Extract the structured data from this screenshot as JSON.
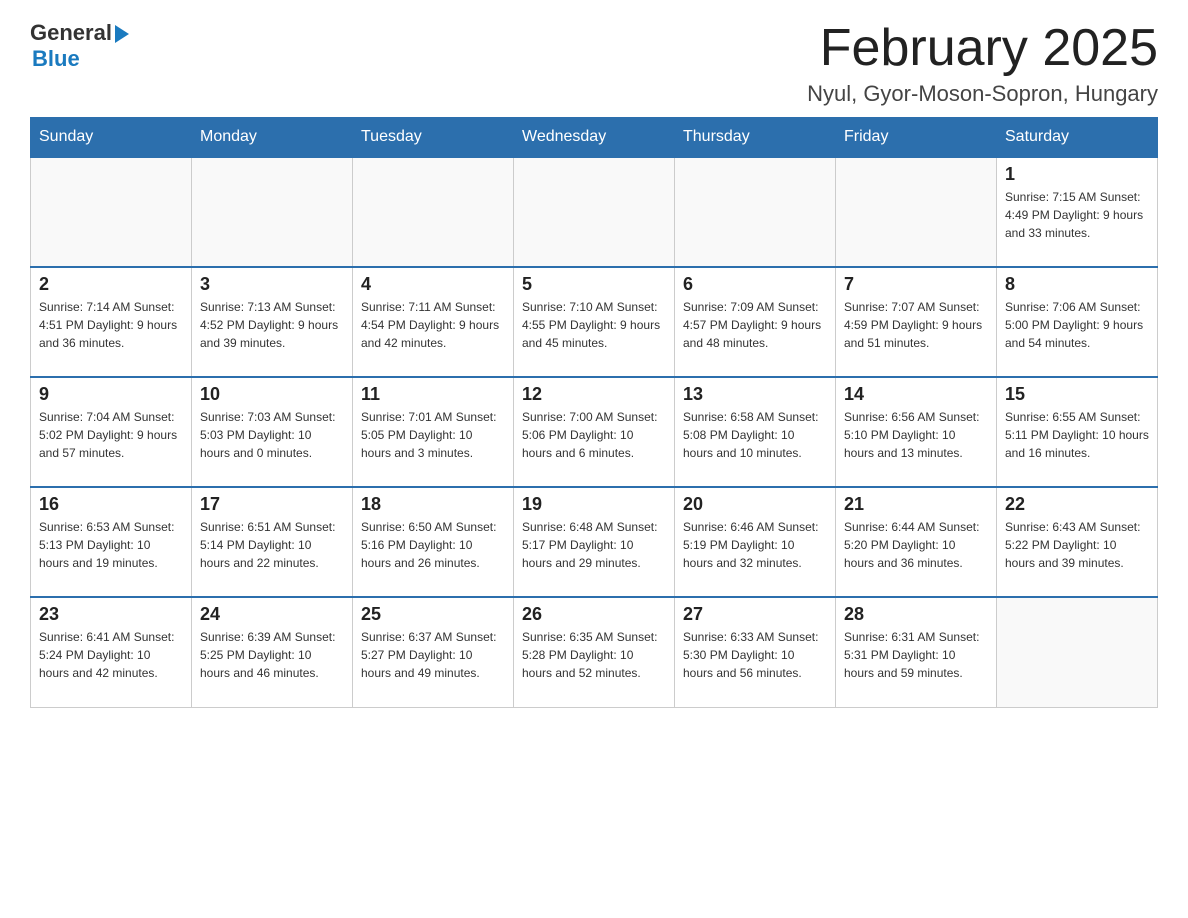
{
  "header": {
    "logo": {
      "general": "General",
      "blue": "Blue"
    },
    "title": "February 2025",
    "location": "Nyul, Gyor-Moson-Sopron, Hungary"
  },
  "days_of_week": [
    "Sunday",
    "Monday",
    "Tuesday",
    "Wednesday",
    "Thursday",
    "Friday",
    "Saturday"
  ],
  "weeks": [
    {
      "days": [
        {
          "number": "",
          "info": ""
        },
        {
          "number": "",
          "info": ""
        },
        {
          "number": "",
          "info": ""
        },
        {
          "number": "",
          "info": ""
        },
        {
          "number": "",
          "info": ""
        },
        {
          "number": "",
          "info": ""
        },
        {
          "number": "1",
          "info": "Sunrise: 7:15 AM\nSunset: 4:49 PM\nDaylight: 9 hours\nand 33 minutes."
        }
      ]
    },
    {
      "days": [
        {
          "number": "2",
          "info": "Sunrise: 7:14 AM\nSunset: 4:51 PM\nDaylight: 9 hours\nand 36 minutes."
        },
        {
          "number": "3",
          "info": "Sunrise: 7:13 AM\nSunset: 4:52 PM\nDaylight: 9 hours\nand 39 minutes."
        },
        {
          "number": "4",
          "info": "Sunrise: 7:11 AM\nSunset: 4:54 PM\nDaylight: 9 hours\nand 42 minutes."
        },
        {
          "number": "5",
          "info": "Sunrise: 7:10 AM\nSunset: 4:55 PM\nDaylight: 9 hours\nand 45 minutes."
        },
        {
          "number": "6",
          "info": "Sunrise: 7:09 AM\nSunset: 4:57 PM\nDaylight: 9 hours\nand 48 minutes."
        },
        {
          "number": "7",
          "info": "Sunrise: 7:07 AM\nSunset: 4:59 PM\nDaylight: 9 hours\nand 51 minutes."
        },
        {
          "number": "8",
          "info": "Sunrise: 7:06 AM\nSunset: 5:00 PM\nDaylight: 9 hours\nand 54 minutes."
        }
      ]
    },
    {
      "days": [
        {
          "number": "9",
          "info": "Sunrise: 7:04 AM\nSunset: 5:02 PM\nDaylight: 9 hours\nand 57 minutes."
        },
        {
          "number": "10",
          "info": "Sunrise: 7:03 AM\nSunset: 5:03 PM\nDaylight: 10 hours\nand 0 minutes."
        },
        {
          "number": "11",
          "info": "Sunrise: 7:01 AM\nSunset: 5:05 PM\nDaylight: 10 hours\nand 3 minutes."
        },
        {
          "number": "12",
          "info": "Sunrise: 7:00 AM\nSunset: 5:06 PM\nDaylight: 10 hours\nand 6 minutes."
        },
        {
          "number": "13",
          "info": "Sunrise: 6:58 AM\nSunset: 5:08 PM\nDaylight: 10 hours\nand 10 minutes."
        },
        {
          "number": "14",
          "info": "Sunrise: 6:56 AM\nSunset: 5:10 PM\nDaylight: 10 hours\nand 13 minutes."
        },
        {
          "number": "15",
          "info": "Sunrise: 6:55 AM\nSunset: 5:11 PM\nDaylight: 10 hours\nand 16 minutes."
        }
      ]
    },
    {
      "days": [
        {
          "number": "16",
          "info": "Sunrise: 6:53 AM\nSunset: 5:13 PM\nDaylight: 10 hours\nand 19 minutes."
        },
        {
          "number": "17",
          "info": "Sunrise: 6:51 AM\nSunset: 5:14 PM\nDaylight: 10 hours\nand 22 minutes."
        },
        {
          "number": "18",
          "info": "Sunrise: 6:50 AM\nSunset: 5:16 PM\nDaylight: 10 hours\nand 26 minutes."
        },
        {
          "number": "19",
          "info": "Sunrise: 6:48 AM\nSunset: 5:17 PM\nDaylight: 10 hours\nand 29 minutes."
        },
        {
          "number": "20",
          "info": "Sunrise: 6:46 AM\nSunset: 5:19 PM\nDaylight: 10 hours\nand 32 minutes."
        },
        {
          "number": "21",
          "info": "Sunrise: 6:44 AM\nSunset: 5:20 PM\nDaylight: 10 hours\nand 36 minutes."
        },
        {
          "number": "22",
          "info": "Sunrise: 6:43 AM\nSunset: 5:22 PM\nDaylight: 10 hours\nand 39 minutes."
        }
      ]
    },
    {
      "days": [
        {
          "number": "23",
          "info": "Sunrise: 6:41 AM\nSunset: 5:24 PM\nDaylight: 10 hours\nand 42 minutes."
        },
        {
          "number": "24",
          "info": "Sunrise: 6:39 AM\nSunset: 5:25 PM\nDaylight: 10 hours\nand 46 minutes."
        },
        {
          "number": "25",
          "info": "Sunrise: 6:37 AM\nSunset: 5:27 PM\nDaylight: 10 hours\nand 49 minutes."
        },
        {
          "number": "26",
          "info": "Sunrise: 6:35 AM\nSunset: 5:28 PM\nDaylight: 10 hours\nand 52 minutes."
        },
        {
          "number": "27",
          "info": "Sunrise: 6:33 AM\nSunset: 5:30 PM\nDaylight: 10 hours\nand 56 minutes."
        },
        {
          "number": "28",
          "info": "Sunrise: 6:31 AM\nSunset: 5:31 PM\nDaylight: 10 hours\nand 59 minutes."
        },
        {
          "number": "",
          "info": ""
        }
      ]
    }
  ]
}
